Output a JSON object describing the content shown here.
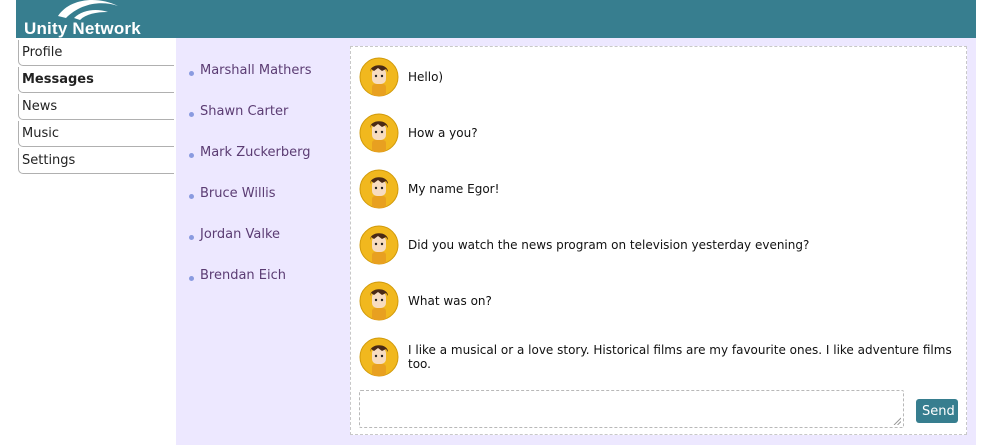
{
  "header": {
    "brand": "Unity Network",
    "logo_icon": "swoosh-logo-icon"
  },
  "nav": {
    "items": [
      {
        "label": "Profile",
        "active": false
      },
      {
        "label": "Messages",
        "active": true
      },
      {
        "label": "News",
        "active": false
      },
      {
        "label": "Music",
        "active": false
      },
      {
        "label": "Settings",
        "active": false
      }
    ]
  },
  "dialogs": {
    "items": [
      {
        "name": "Marshall Mathers"
      },
      {
        "name": "Shawn Carter"
      },
      {
        "name": "Mark Zuckerberg"
      },
      {
        "name": "Bruce Willis"
      },
      {
        "name": "Jordan Valke"
      },
      {
        "name": "Brendan Eich"
      }
    ]
  },
  "messages": {
    "items": [
      {
        "text": "Hello)"
      },
      {
        "text": "How a you?"
      },
      {
        "text": "My name Egor!"
      },
      {
        "text": "Did you watch the news program on television yesterday evening?"
      },
      {
        "text": "What was on?"
      },
      {
        "text": "I like a musical or a love story. Historical films are my favourite ones. I like adventure films too."
      }
    ],
    "avatar_icon": "user-avatar-icon"
  },
  "composer": {
    "value": "",
    "placeholder": "",
    "send_label": "Send"
  },
  "colors": {
    "header_bg": "#377e8f",
    "content_bg": "#ede8ff",
    "dialog_link": "#5b3c73",
    "bullet": "#8a9be0",
    "send_button": "#377e8f"
  }
}
